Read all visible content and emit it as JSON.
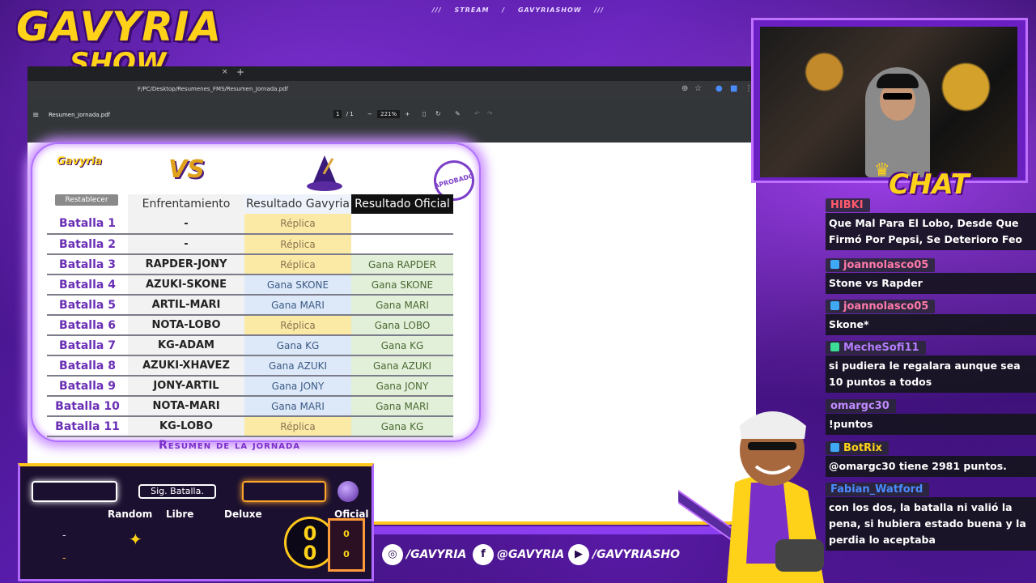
{
  "stream_header": {
    "prefix": "///",
    "stream": "STREAM",
    "sep": "/",
    "channel": "GAVYRIASHOW",
    "suffix": "///"
  },
  "logo": {
    "line1": "GAVYRIA",
    "line2": "SHOW"
  },
  "browser": {
    "tab_close": "×",
    "tab_new": "+",
    "url": "F/PC/Desktop/Resumenes_FMS/Resumen_Jornada.pdf",
    "pdf_name": "Resumen_Jornada.pdf",
    "page_current": "1",
    "page_total": "/ 1",
    "zoom": "221%",
    "zoom_minus": "−",
    "zoom_plus": "+"
  },
  "summary": {
    "minilogo": "Gavyria",
    "vs": "VS",
    "seal": "APROBADO",
    "reset_label": "Restablecer",
    "headers": [
      "Enfrentamiento",
      "Resultado Gavyria",
      "Resultado Oficial"
    ],
    "rows": [
      {
        "batalla": "Batalla 1",
        "enf": "-",
        "gav": "Réplica",
        "gav_c": "yel",
        "of": "",
        "of_c": "wht"
      },
      {
        "batalla": "Batalla 2",
        "enf": "-",
        "gav": "Réplica",
        "gav_c": "yel",
        "of": "",
        "of_c": "wht"
      },
      {
        "batalla": "Batalla 3",
        "enf": "RAPDER-JONY",
        "gav": "Réplica",
        "gav_c": "yel",
        "of": "Gana RAPDER",
        "of_c": "grn"
      },
      {
        "batalla": "Batalla 4",
        "enf": "AZUKI-SKONE",
        "gav": "Gana SKONE",
        "gav_c": "blu",
        "of": "Gana SKONE",
        "of_c": "grn"
      },
      {
        "batalla": "Batalla 5",
        "enf": "ARTIL-MARI",
        "gav": "Gana MARI",
        "gav_c": "blu",
        "of": "Gana MARI",
        "of_c": "grn"
      },
      {
        "batalla": "Batalla 6",
        "enf": "NOTA-LOBO",
        "gav": "Réplica",
        "gav_c": "yel",
        "of": "Gana LOBO",
        "of_c": "grn"
      },
      {
        "batalla": "Batalla 7",
        "enf": "KG-ADAM",
        "gav": "Gana KG",
        "gav_c": "blu",
        "of": "Gana KG",
        "of_c": "grn"
      },
      {
        "batalla": "Batalla 8",
        "enf": "AZUKI-XHAVEZ",
        "gav": "Gana AZUKI",
        "gav_c": "blu",
        "of": "Gana AZUKI",
        "of_c": "grn"
      },
      {
        "batalla": "Batalla 9",
        "enf": "JONY-ARTIL",
        "gav": "Gana JONY",
        "gav_c": "blu",
        "of": "Gana JONY",
        "of_c": "grn"
      },
      {
        "batalla": "Batalla 10",
        "enf": "NOTA-MARI",
        "gav": "Gana MARI",
        "gav_c": "blu",
        "of": "Gana MARI",
        "of_c": "grn"
      },
      {
        "batalla": "Batalla 11",
        "enf": "KG-LOBO",
        "gav": "Réplica",
        "gav_c": "yel",
        "of": "Gana KG",
        "of_c": "grn"
      }
    ],
    "footer": "Resumen de la jornada"
  },
  "chat": {
    "title": "CHAT",
    "messages": [
      {
        "user": "HIBKI",
        "color": "#ff5a6a",
        "badge": "",
        "text": "Que Mal Para El Lobo, Desde Que Firmó Por Pepsi, Se Deterioro Feo"
      },
      {
        "user": "joannolasco05",
        "color": "#ff7aa8",
        "badge": "#3fa9f5",
        "text": "Stone vs Rapder"
      },
      {
        "user": "joannolasco05",
        "color": "#ff7aa8",
        "badge": "#3fa9f5",
        "text": "Skone*"
      },
      {
        "user": "MecheSofi11",
        "color": "#b57cff",
        "badge": "#3ddc97",
        "text": "si pudiera le regalara aunque sea 10 puntos a todos"
      },
      {
        "user": "omargc30",
        "color": "#c08aff",
        "badge": "",
        "text": "!puntos"
      },
      {
        "user": "BotRix",
        "color": "#ffd21a",
        "badge": "#3fa9f5",
        "text": "@omargc30 tiene 2981 puntos."
      },
      {
        "user": "Fabian_Watford",
        "color": "#4a8cff",
        "badge": "",
        "text": "con los dos, la batalla ni valió la pena, si hubiera estado buena y la perdia lo aceptaba"
      }
    ]
  },
  "control": {
    "next_label": "Sig. Batalla.",
    "cols": [
      "Random",
      "Libre",
      "Deluxe",
      "Oficial"
    ],
    "dash": "-",
    "score_top": "0",
    "score_bottom": "0",
    "oficial_top": "0",
    "oficial_bottom": "0"
  },
  "socials": [
    {
      "icon": "instagram-icon",
      "glyph": "◎",
      "handle": "/GAVYRIA"
    },
    {
      "icon": "facebook-icon",
      "glyph": "f",
      "handle": "@GAVYRIA"
    },
    {
      "icon": "youtube-icon",
      "glyph": "▶",
      "handle": "/GAVYRIASHO"
    }
  ],
  "colors": {
    "accent": "#ffd21a",
    "purple": "#7a2fc9",
    "bg": "#2a0b52"
  }
}
